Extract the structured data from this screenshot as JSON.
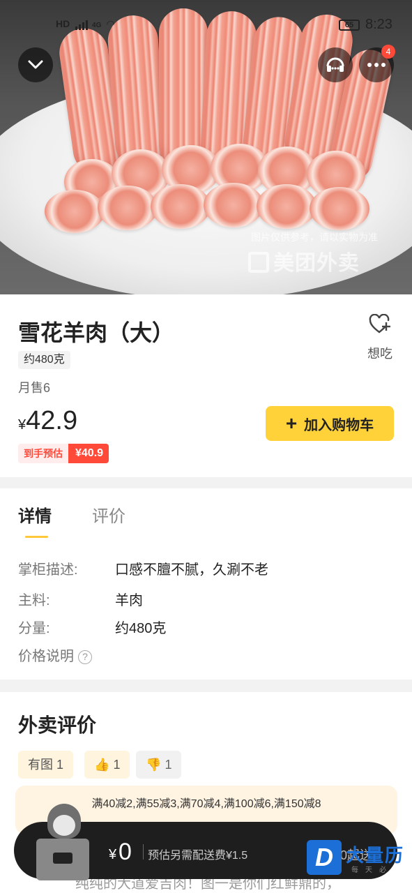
{
  "status_bar": {
    "network": "HD",
    "signal_label": "4G",
    "battery": "65",
    "time": "8:23"
  },
  "hero": {
    "watermark_note": "图片仅供参考，请以实物为准",
    "watermark_brand": "美团外卖",
    "more_badge_count": "4"
  },
  "product": {
    "name": "雪花羊肉（大）",
    "spec": "约480克",
    "monthly_sales": "月售6",
    "currency": "¥",
    "price": "42.9",
    "estimate_label": "到手预估",
    "estimate_price": "¥40.9",
    "favorite_label": "想吃",
    "add_to_cart": "加入购物车"
  },
  "details": {
    "tabs": [
      {
        "label": "详情",
        "active": true
      },
      {
        "label": "评价",
        "active": false
      }
    ],
    "rows": [
      {
        "key": "掌柜描述:",
        "value": "口感不膻不腻，久涮不老"
      },
      {
        "key": "主料:",
        "value": "羊肉"
      },
      {
        "key": "分量:",
        "value": "约480克"
      }
    ],
    "price_note_label": "价格说明",
    "help_glyph": "?"
  },
  "reviews": {
    "title": "外卖评价",
    "filters": [
      {
        "label": "有图",
        "count": "1"
      },
      {
        "label": "",
        "count": "1",
        "icon": "thumbs-up-icon"
      },
      {
        "label": "",
        "count": "1",
        "icon": "thumbs-down-icon"
      }
    ],
    "promo_text": "满40减2,满55减3,满70减4,满100减6,满150减8",
    "snippet": "纯纯的大道爱吉肉！图一是你们红鲜鼎的，"
  },
  "cart": {
    "currency": "¥",
    "total": "0",
    "delivery_fee_note": "预估另需配送费¥1.5",
    "min_order": "¥30起送"
  },
  "corner_watermark": {
    "logo_letter": "D",
    "name": "大量历",
    "sub": "每天必"
  },
  "colors": {
    "accent_yellow": "#ffd23a",
    "price_red": "#ff4a3a",
    "tab_underline": "#ffc83a",
    "cart_bar": "#1e1e1e"
  }
}
